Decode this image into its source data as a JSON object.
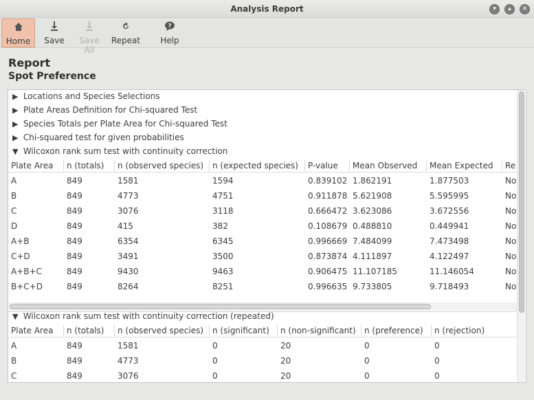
{
  "window": {
    "title": "Analysis Report"
  },
  "toolbar": {
    "home": "Home",
    "save": "Save",
    "save_all": "Save All",
    "repeat": "Repeat",
    "help": "Help"
  },
  "report": {
    "title": "Report",
    "subtitle": "Spot Preference"
  },
  "sections": {
    "s1": "Locations and Species Selections",
    "s2": "Plate Areas Definition for Chi-squared Test",
    "s3": "Species Totals per Plate Area for Chi-squared Test",
    "s4": "Chi-squared test for given probabilities",
    "s5": "Wilcoxon rank sum test with continuity correction",
    "s6": "Wilcoxon rank sum test with continuity correction (repeated)"
  },
  "table1": {
    "headers": [
      "Plate Area",
      "n (totals)",
      "n (observed species)",
      "n (expected species)",
      "P-value",
      "Mean Observed",
      "Mean Expected",
      "Re"
    ],
    "rows": [
      [
        "A",
        "849",
        "1581",
        "1594",
        "0.839102",
        "1.862191",
        "1.877503",
        "Not"
      ],
      [
        "B",
        "849",
        "4773",
        "4751",
        "0.911878",
        "5.621908",
        "5.595995",
        "Not"
      ],
      [
        "C",
        "849",
        "3076",
        "3118",
        "0.666472",
        "3.623086",
        "3.672556",
        "Not"
      ],
      [
        "D",
        "849",
        "415",
        "382",
        "0.108679",
        "0.488810",
        "0.449941",
        "Not"
      ],
      [
        "A+B",
        "849",
        "6354",
        "6345",
        "0.996669",
        "7.484099",
        "7.473498",
        "Not"
      ],
      [
        "C+D",
        "849",
        "3491",
        "3500",
        "0.873874",
        "4.111897",
        "4.122497",
        "Not"
      ],
      [
        "A+B+C",
        "849",
        "9430",
        "9463",
        "0.906475",
        "11.107185",
        "11.146054",
        "Not"
      ],
      [
        "B+C+D",
        "849",
        "8264",
        "8251",
        "0.996635",
        "9.733805",
        "9.718493",
        "Not"
      ]
    ]
  },
  "table2": {
    "headers": [
      "Plate Area",
      "n (totals)",
      "n (observed species)",
      "n (significant)",
      "n (non-significant)",
      "n (preference)",
      "n (rejection)"
    ],
    "rows": [
      [
        "A",
        "849",
        "1581",
        "0",
        "20",
        "0",
        "0"
      ],
      [
        "B",
        "849",
        "4773",
        "0",
        "20",
        "0",
        "0"
      ],
      [
        "C",
        "849",
        "3076",
        "0",
        "20",
        "0",
        "0"
      ]
    ]
  },
  "icons": {
    "home": "home-icon",
    "save": "save-icon",
    "save_all": "save-all-icon",
    "repeat": "repeat-icon",
    "help": "help-icon"
  }
}
